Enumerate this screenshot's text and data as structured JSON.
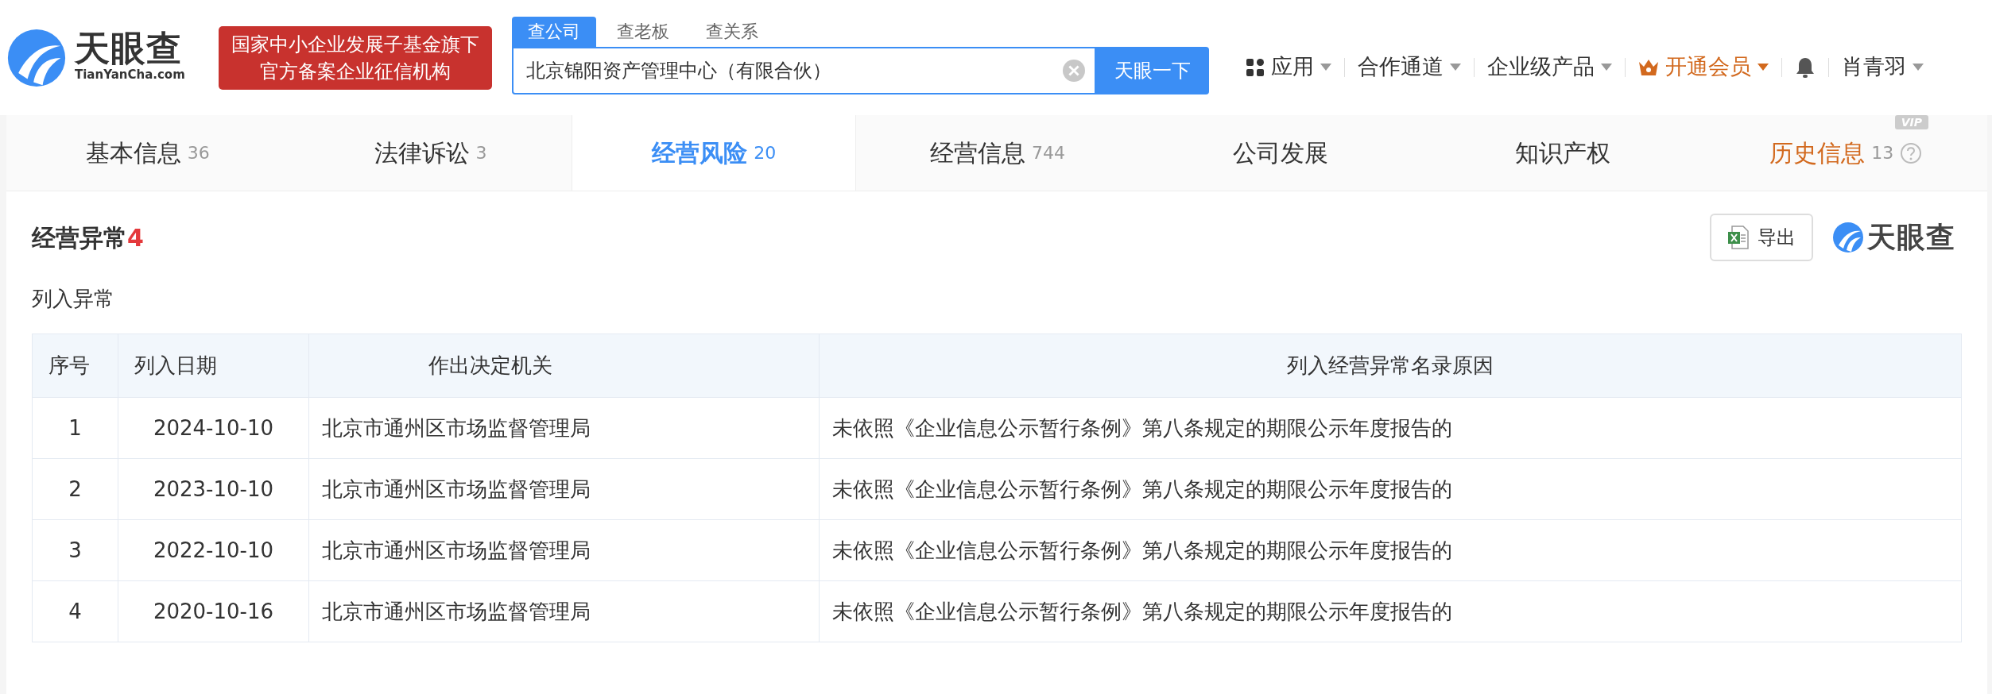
{
  "header": {
    "logo": {
      "name": "天眼查",
      "domain": "TianYanCha.com"
    },
    "badge_lines": [
      "国家中小企业发展子基金旗下",
      "官方备案企业征信机构"
    ],
    "search_tabs": [
      {
        "label": "查公司",
        "selected": true
      },
      {
        "label": "查老板",
        "selected": false
      },
      {
        "label": "查关系",
        "selected": false
      }
    ],
    "search": {
      "value": "北京锦阳资产管理中心（有限合伙）",
      "button": "天眼一下"
    },
    "nav": [
      {
        "kind": "apps",
        "label": "应用"
      },
      {
        "kind": "plain",
        "label": "合作通道"
      },
      {
        "kind": "plain",
        "label": "企业级产品"
      },
      {
        "kind": "vip",
        "label": "开通会员"
      },
      {
        "kind": "bell"
      },
      {
        "kind": "plain",
        "label": "肖青羽"
      }
    ]
  },
  "tabs": [
    {
      "label": "基本信息",
      "count": "36",
      "selected": false,
      "vip": false
    },
    {
      "label": "法律诉讼",
      "count": "3",
      "selected": false,
      "vip": false
    },
    {
      "label": "经营风险",
      "count": "20",
      "selected": true,
      "vip": false
    },
    {
      "label": "经营信息",
      "count": "744",
      "selected": false,
      "vip": false
    },
    {
      "label": "公司发展",
      "selected": false,
      "vip": false
    },
    {
      "label": "知识产权",
      "selected": false,
      "vip": false
    },
    {
      "label": "历史信息",
      "count": "13",
      "selected": false,
      "vip": true,
      "badge": "VIP"
    }
  ],
  "section": {
    "title": "经营异常",
    "count": "4",
    "subtitle": "列入异常",
    "export_button": "导出",
    "brand": "天眼查"
  },
  "table": {
    "columns": [
      "序号",
      "列入日期",
      "作出决定机关",
      "列入经营异常名录原因"
    ],
    "rows": [
      [
        "1",
        "2024-10-10",
        "北京市通州区市场监督管理局",
        "未依照《企业信息公示暂行条例》第八条规定的期限公示年度报告的"
      ],
      [
        "2",
        "2023-10-10",
        "北京市通州区市场监督管理局",
        "未依照《企业信息公示暂行条例》第八条规定的期限公示年度报告的"
      ],
      [
        "3",
        "2022-10-10",
        "北京市通州区市场监督管理局",
        "未依照《企业信息公示暂行条例》第八条规定的期限公示年度报告的"
      ],
      [
        "4",
        "2020-10-16",
        "北京市通州区市场监督管理局",
        "未依照《企业信息公示暂行条例》第八条规定的期限公示年度报告的"
      ]
    ]
  }
}
